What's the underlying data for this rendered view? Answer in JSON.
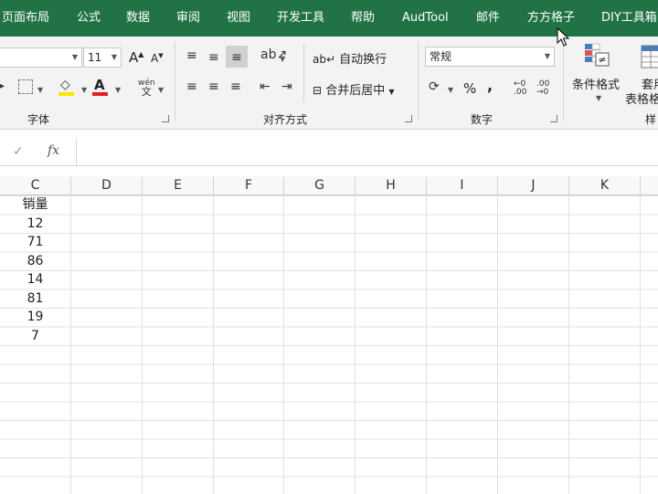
{
  "tabs": [
    "页面布局",
    "公式",
    "数据",
    "审阅",
    "视图",
    "开发工具",
    "帮助",
    "AudTool",
    "邮件",
    "方方格子",
    "DIY工具箱"
  ],
  "ribbon": {
    "font": {
      "size_value": "11",
      "grow_label": "A",
      "shrink_label": "A",
      "phonetic_top": "wén",
      "phonetic_bottom": "文",
      "group_label": "字体"
    },
    "alignment": {
      "wrap_text_label": "自动换行",
      "merge_center_label": "合并后居中",
      "group_label": "对齐方式"
    },
    "number": {
      "format_value": "常规",
      "percent_label": "%",
      "comma_label": ",",
      "group_label": "数字"
    },
    "styles": {
      "conditional_label": "条件格式",
      "table_label_1": "套用",
      "table_label_2": "表格格",
      "group_label_partial": "样"
    }
  },
  "formula_bar": {
    "fx_label": "fx",
    "check_label": "✓",
    "value": ""
  },
  "columns": [
    "C",
    "D",
    "E",
    "F",
    "G",
    "H",
    "I",
    "J",
    "K"
  ],
  "sheet": {
    "header_cell": "销量",
    "values": [
      "12",
      "71",
      "86",
      "14",
      "81",
      "19",
      "7"
    ]
  },
  "colors": {
    "tab_bar": "#217346",
    "ribbon_bg": "#f3f3f3",
    "fill_color": "#ffe600",
    "font_color": "#e51c23"
  }
}
